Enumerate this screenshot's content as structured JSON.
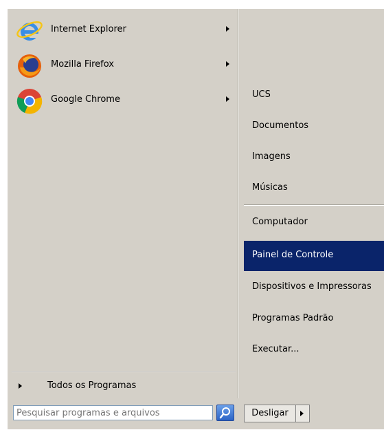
{
  "programs": [
    {
      "label": "Internet Explorer",
      "icon": "internet-explorer-icon"
    },
    {
      "label": "Mozilla Firefox",
      "icon": "firefox-icon"
    },
    {
      "label": "Google Chrome",
      "icon": "chrome-icon"
    }
  ],
  "all_programs": {
    "label": "Todos os Programas"
  },
  "places": [
    {
      "label": "UCS"
    },
    {
      "label": "Documentos"
    },
    {
      "label": "Imagens"
    },
    {
      "label": "Músicas"
    },
    {
      "label": "Computador"
    },
    {
      "label": "Painel de Controle",
      "selected": true
    },
    {
      "label": "Dispositivos e Impressoras"
    },
    {
      "label": "Programas Padrão"
    },
    {
      "label": "Executar..."
    }
  ],
  "search": {
    "placeholder": "Pesquisar programas e arquivos",
    "value": ""
  },
  "shutdown": {
    "label": "Desligar"
  },
  "colors": {
    "menu_bg": "#d4d0c8",
    "selection": "#0a246a",
    "selection_text": "#ffffff"
  }
}
